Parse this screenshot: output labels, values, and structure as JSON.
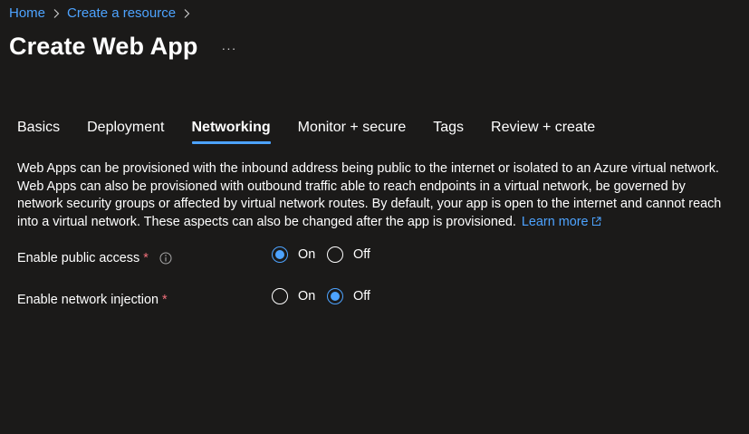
{
  "breadcrumb": {
    "items": [
      {
        "label": "Home"
      },
      {
        "label": "Create a resource"
      }
    ]
  },
  "page": {
    "title": "Create Web App",
    "more_label": "···"
  },
  "tabs": [
    {
      "label": "Basics",
      "active": false
    },
    {
      "label": "Deployment",
      "active": false
    },
    {
      "label": "Networking",
      "active": true
    },
    {
      "label": "Monitor + secure",
      "active": false
    },
    {
      "label": "Tags",
      "active": false
    },
    {
      "label": "Review + create",
      "active": false
    }
  ],
  "description": {
    "text": "Web Apps can be provisioned with the inbound address being public to the internet or isolated to an Azure virtual network. Web Apps can also be provisioned with outbound traffic able to reach endpoints in a virtual network, be governed by network security groups or affected by virtual network routes. By default, your app is open to the internet and cannot reach into a virtual network. These aspects can also be changed after the app is provisioned.",
    "learn_more": "Learn more"
  },
  "fields": {
    "public_access": {
      "label": "Enable public access",
      "required_mark": "*",
      "info_icon": "info-icon",
      "options": [
        "On",
        "Off"
      ],
      "selected": "On"
    },
    "network_injection": {
      "label": "Enable network injection",
      "required_mark": "*",
      "options": [
        "On",
        "Off"
      ],
      "selected": "Off"
    }
  },
  "colors": {
    "background": "#1b1a19",
    "accent": "#4da3ff",
    "required": "#f1707b",
    "text": "#ffffff"
  }
}
